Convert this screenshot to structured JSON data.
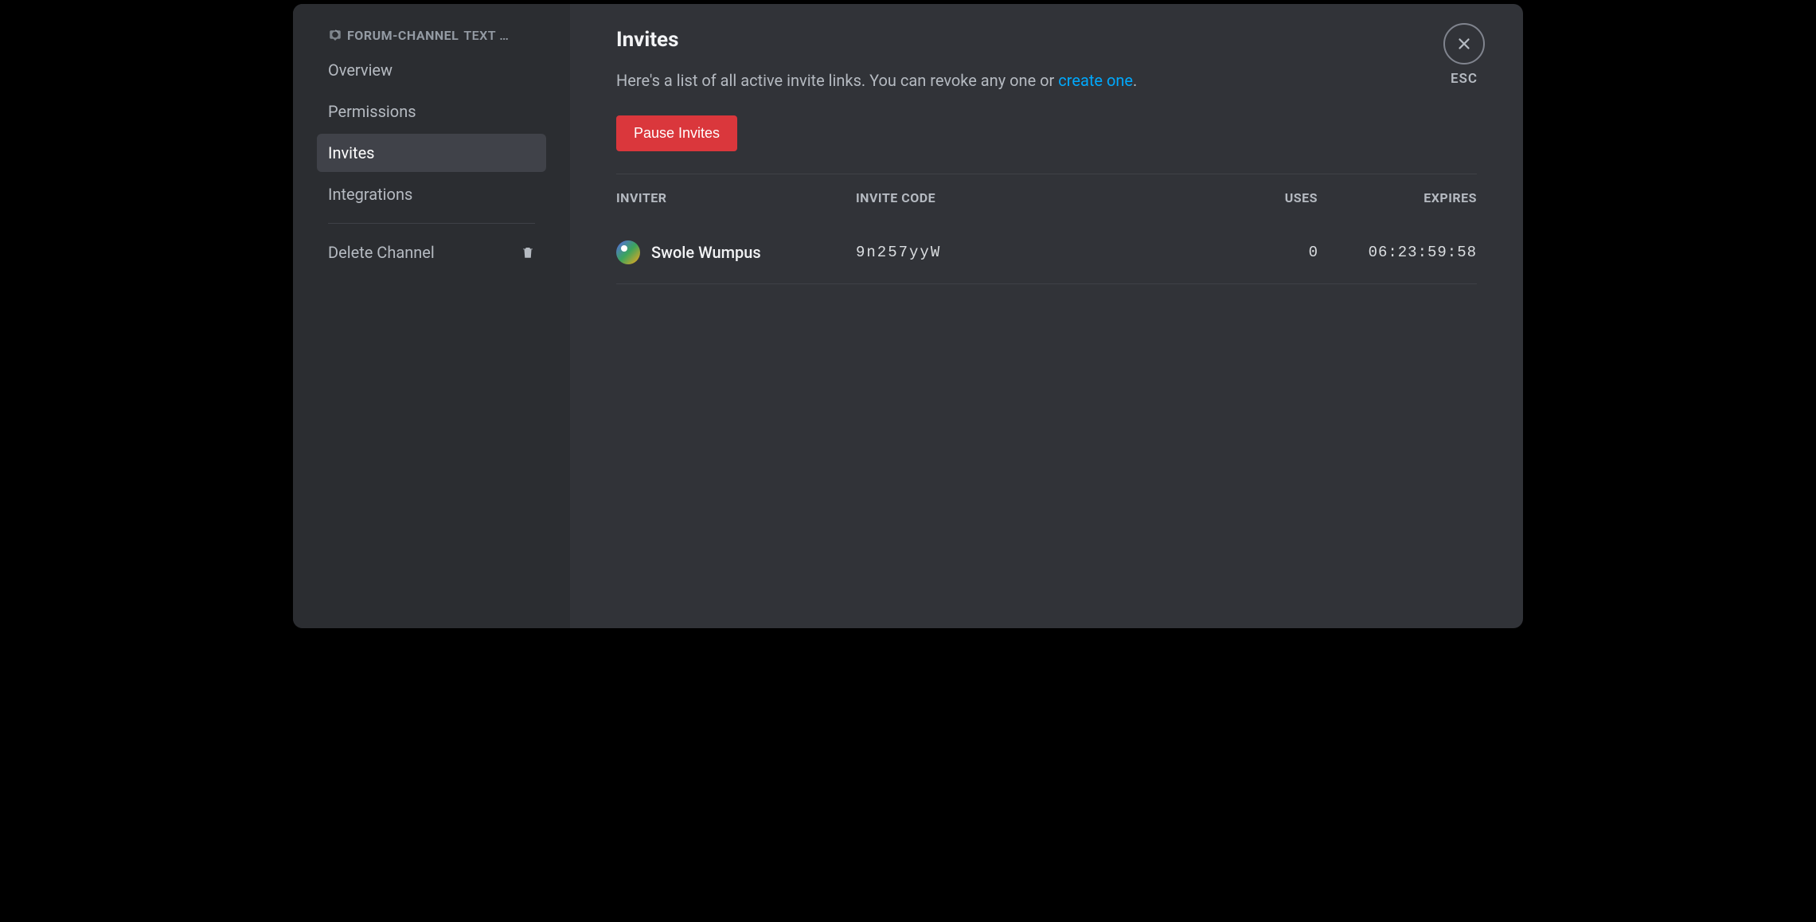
{
  "sidebar": {
    "channel_name": "FORUM-CHANNEL",
    "channel_suffix": "TEXT …",
    "items": [
      {
        "label": "Overview",
        "active": false
      },
      {
        "label": "Permissions",
        "active": false
      },
      {
        "label": "Invites",
        "active": true
      },
      {
        "label": "Integrations",
        "active": false
      }
    ],
    "delete_label": "Delete Channel"
  },
  "main": {
    "title": "Invites",
    "description_prefix": "Here's a list of all active invite links. You can revoke any one or ",
    "create_link_text": "create one",
    "description_suffix": ".",
    "pause_button": "Pause Invites",
    "columns": {
      "inviter": "INVITER",
      "code": "INVITE CODE",
      "uses": "USES",
      "expires": "EXPIRES"
    },
    "invites": [
      {
        "inviter": "Swole Wumpus",
        "code": "9n257yyW",
        "uses": "0",
        "expires": "06:23:59:58"
      }
    ]
  },
  "close": {
    "esc_label": "ESC"
  }
}
